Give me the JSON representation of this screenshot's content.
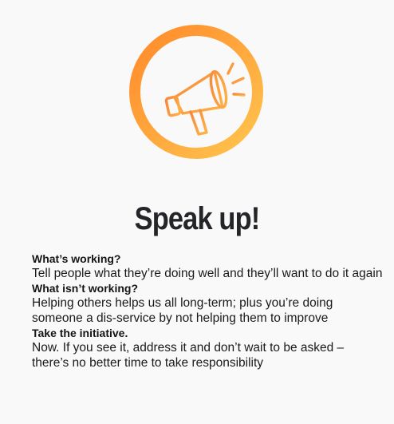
{
  "icon": {
    "name": "megaphone-icon",
    "ring_gradient": [
      "#ff8a2b",
      "#ffc44e"
    ],
    "stroke_color": "#f7a042"
  },
  "title": "Speak up!",
  "sections": [
    {
      "heading": "What’s working?",
      "body": "Tell people what they’re doing well and they’ll want to do it again"
    },
    {
      "heading": "What isn’t working?",
      "body": "Helping others helps us all long-term; plus you’re doing someone a dis-service by not helping them to improve"
    },
    {
      "heading": "Take the initiative.",
      "body": "Now. If you see it, address it and don’t wait to be asked – there’s no better time to take responsibility"
    }
  ]
}
